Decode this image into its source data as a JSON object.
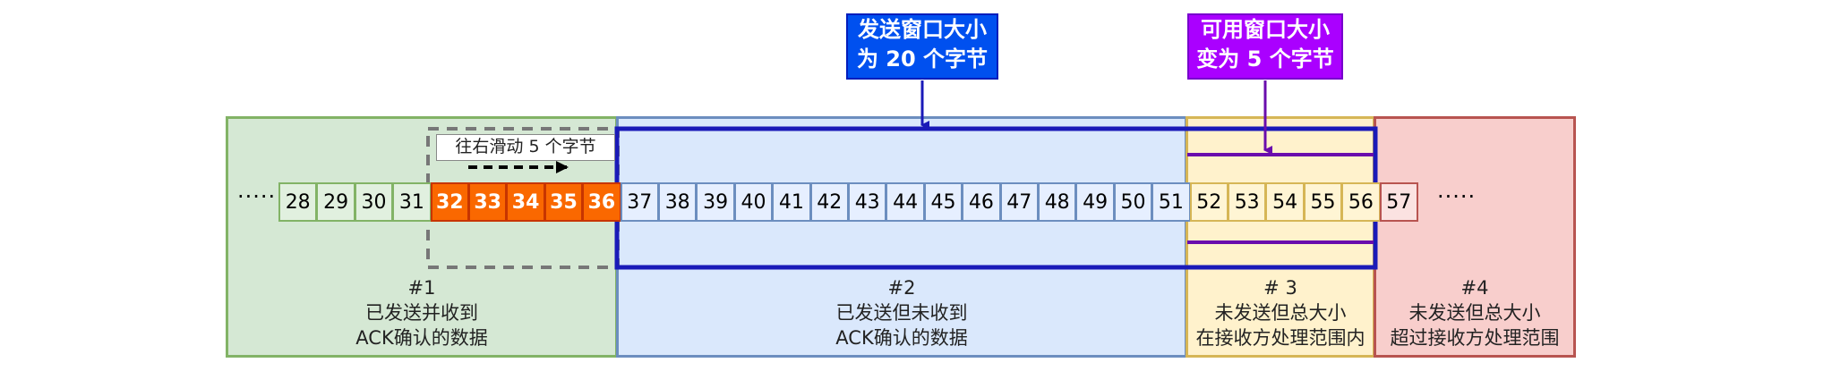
{
  "callouts": {
    "send_window": {
      "line1": "发送窗口大小",
      "line2": "为 20 个字节",
      "color": "#0050ef"
    },
    "usable_window": {
      "line1": "可用窗口大小",
      "line2": "变为 5 个字节",
      "color": "#aa00ff"
    }
  },
  "slide_label": "往右滑动 5 个字节",
  "ellipsis_left": "·····",
  "ellipsis_right": "·····",
  "cells": {
    "green": [
      "28",
      "29",
      "30",
      "31"
    ],
    "orange": [
      "32",
      "33",
      "34",
      "35",
      "36"
    ],
    "blue": [
      "37",
      "38",
      "39",
      "40",
      "41",
      "42",
      "43",
      "44",
      "45",
      "46",
      "47",
      "48",
      "49",
      "50",
      "51"
    ],
    "yellow": [
      "52",
      "53",
      "54",
      "55",
      "56"
    ],
    "red": [
      "57"
    ]
  },
  "regions": [
    {
      "id": "#1",
      "line1": "已发送并收到",
      "line2": "ACK确认的数据",
      "fill": "#d5e8d4",
      "border": "#82b366"
    },
    {
      "id": "#2",
      "line1": "已发送但未收到",
      "line2": "ACK确认的数据",
      "fill": "#dae8fc",
      "border": "#6c8ebf"
    },
    {
      "id": "# 3",
      "line1": "未发送但总大小",
      "line2": "在接收方处理范围内",
      "fill": "#fff2cc",
      "border": "#d6b656"
    },
    {
      "id": "#4",
      "line1": "未发送但总大小",
      "line2": "超过接收方处理范围",
      "fill": "#f8cecc",
      "border": "#b85450"
    }
  ]
}
